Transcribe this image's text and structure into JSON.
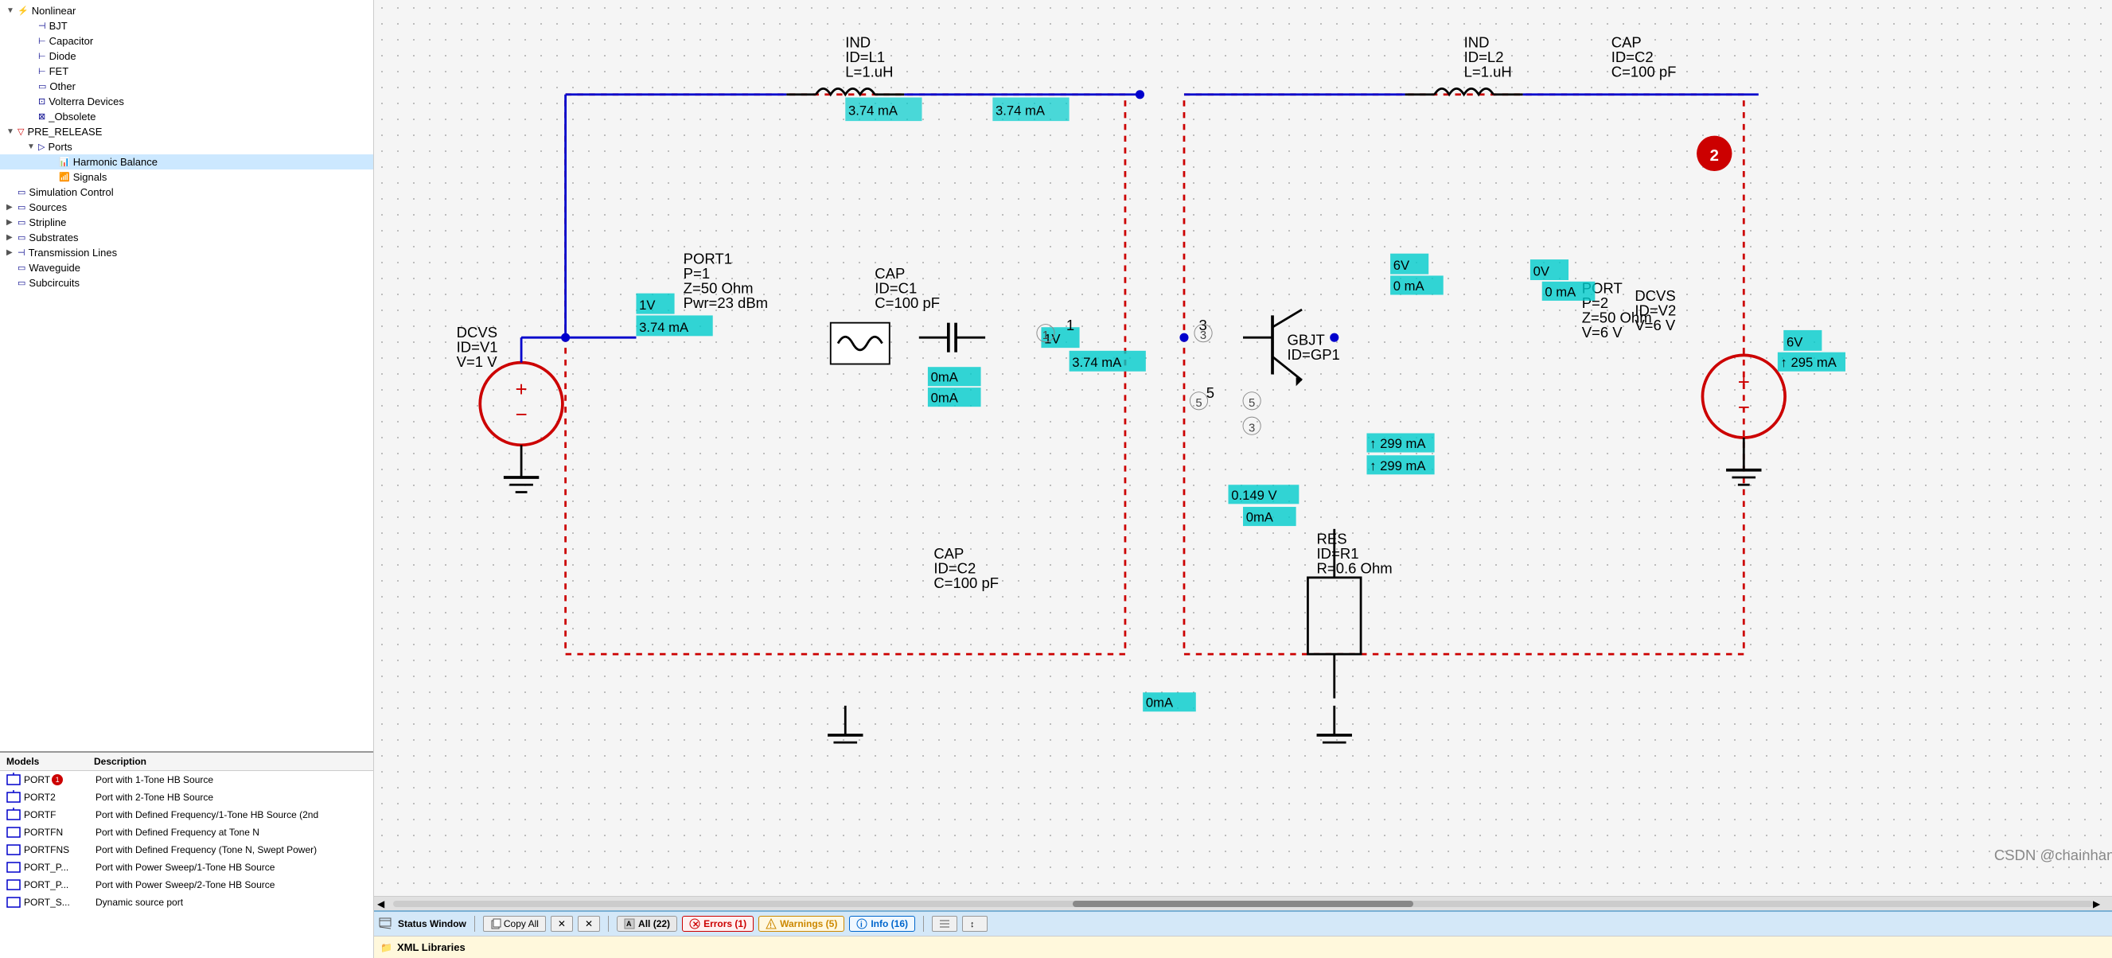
{
  "tree": {
    "items": [
      {
        "id": "nonlinear",
        "label": "Nonlinear",
        "level": 1,
        "expanded": true,
        "icon": "fork",
        "type": "expand"
      },
      {
        "id": "bjt",
        "label": "BJT",
        "level": 2,
        "icon": "bjt",
        "type": "leaf"
      },
      {
        "id": "capacitor",
        "label": "Capacitor",
        "level": 2,
        "icon": "cap",
        "type": "leaf"
      },
      {
        "id": "diode",
        "label": "Diode",
        "level": 2,
        "icon": "diode",
        "type": "leaf"
      },
      {
        "id": "fet",
        "label": "FET",
        "level": 2,
        "icon": "fet",
        "type": "leaf"
      },
      {
        "id": "other",
        "label": "Other",
        "level": 2,
        "icon": "other",
        "type": "leaf"
      },
      {
        "id": "volterra",
        "label": "Volterra Devices",
        "level": 2,
        "icon": "volterra",
        "type": "leaf"
      },
      {
        "id": "obsolete",
        "label": "_Obsolete",
        "level": 2,
        "icon": "obs",
        "type": "leaf"
      },
      {
        "id": "pre_release",
        "label": "PRE_RELEASE",
        "level": 1,
        "expanded": true,
        "icon": "pre",
        "type": "expand"
      },
      {
        "id": "ports",
        "label": "Ports",
        "level": 2,
        "expanded": true,
        "icon": "ports",
        "type": "expand"
      },
      {
        "id": "harmonic_balance",
        "label": "Harmonic Balance",
        "level": 3,
        "icon": "hb",
        "type": "leaf",
        "selected": true
      },
      {
        "id": "signals",
        "label": "Signals",
        "level": 3,
        "icon": "sig",
        "type": "leaf"
      },
      {
        "id": "sim_control",
        "label": "Simulation Control",
        "level": 1,
        "icon": "simctrl",
        "type": "leaf"
      },
      {
        "id": "sources",
        "label": "Sources",
        "level": 1,
        "expanded": false,
        "icon": "src",
        "type": "expand"
      },
      {
        "id": "stripline",
        "label": "Stripline",
        "level": 1,
        "expanded": false,
        "icon": "strip",
        "type": "expand"
      },
      {
        "id": "substrates",
        "label": "Substrates",
        "level": 1,
        "expanded": false,
        "icon": "sub",
        "type": "expand"
      },
      {
        "id": "transmission_lines",
        "label": "Transmission Lines",
        "level": 1,
        "expanded": false,
        "icon": "tl",
        "type": "expand"
      },
      {
        "id": "waveguide",
        "label": "Waveguide",
        "level": 1,
        "icon": "wg",
        "type": "leaf"
      },
      {
        "id": "subcircuits",
        "label": "Subcircuits",
        "level": 1,
        "icon": "sc",
        "type": "leaf"
      }
    ]
  },
  "models": {
    "col_model": "Models",
    "col_desc": "Description",
    "rows": [
      {
        "name": "PORT",
        "badge": "1",
        "desc": "Port with 1-Tone HB Source"
      },
      {
        "name": "PORT2",
        "badge": "",
        "desc": "Port with 2-Tone HB Source"
      },
      {
        "name": "PORTF",
        "badge": "",
        "desc": "Port with Defined Frequency/1-Tone HB Source (2nd"
      },
      {
        "name": "PORTFN",
        "badge": "",
        "desc": "Port with Defined Frequency at Tone N"
      },
      {
        "name": "PORTFNS",
        "badge": "",
        "desc": "Port with Defined Frequency (Tone N, Swept Power)"
      },
      {
        "name": "PORT_P...",
        "badge": "",
        "desc": "Port with Power Sweep/1-Tone HB Source"
      },
      {
        "name": "PORT_P...",
        "badge": "",
        "desc": "Port with Power Sweep/2-Tone HB Source"
      },
      {
        "name": "PORT_S...",
        "badge": "",
        "desc": "Dynamic source port"
      }
    ]
  },
  "status": {
    "window_title": "Status Window",
    "copy_all": "Copy All",
    "close1": "✕",
    "close2": "✕",
    "all_label": "All (22)",
    "errors_label": "Errors (1)",
    "warnings_label": "Warnings (5)",
    "info_label": "Info (16)",
    "sort_icon": "sort"
  },
  "xml": {
    "label": "XML Libraries"
  },
  "watermark": "CSDN @chainhanlin",
  "schematic": {
    "components": [
      {
        "id": "L1",
        "label": "IND\nID=L1\nL=1.uH"
      },
      {
        "id": "L2",
        "label": "IND\nID=L2\nL=1.uH"
      },
      {
        "id": "C1",
        "label": "CAP\nID=C1\nC=100 pF"
      },
      {
        "id": "C2",
        "label": "CAP\nID=C2\nC=100 pF"
      },
      {
        "id": "C_out",
        "label": "CAP\nID=C2\nC=100 pF"
      },
      {
        "id": "R1",
        "label": "RES\nID=R1\nR=0.6 Ohm"
      },
      {
        "id": "PORT1",
        "label": "PORT1\nP=1\nZ=50 Ohm\nPwr=23 dBm"
      },
      {
        "id": "PORT2",
        "label": "PORT\nP=2\nZ=50 Ohm\nV=6 V"
      },
      {
        "id": "DCVS1",
        "label": "DCVS\nID=V1\nV=1 V"
      },
      {
        "id": "DCVS2",
        "label": "DCVS\nID=V2\nV=6 V"
      },
      {
        "id": "GBJT",
        "label": "GBJT\nID=GP1"
      },
      {
        "id": "num2",
        "label": "2"
      }
    ]
  }
}
